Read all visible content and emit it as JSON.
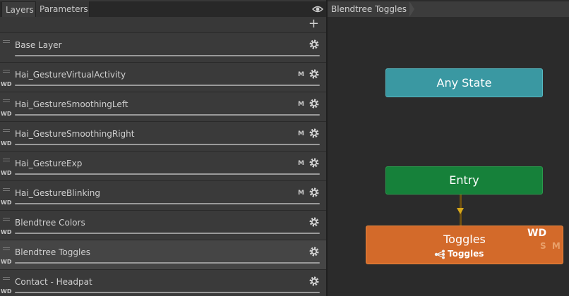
{
  "tabs": [
    {
      "label": "Layers"
    },
    {
      "label": "Parameters"
    }
  ],
  "toolbar": {
    "add_icon": "plus-icon"
  },
  "layers": [
    {
      "name": "Base Layer",
      "wd": "",
      "m": ""
    },
    {
      "name": "Hai_GestureVirtualActivity",
      "wd": "WD",
      "m": "M"
    },
    {
      "name": "Hai_GestureSmoothingLeft",
      "wd": "WD",
      "m": "M"
    },
    {
      "name": "Hai_GestureSmoothingRight",
      "wd": "WD",
      "m": "M"
    },
    {
      "name": "Hai_GestureExp",
      "wd": "WD",
      "m": "M"
    },
    {
      "name": "Hai_GestureBlinking",
      "wd": "WD",
      "m": "M"
    },
    {
      "name": "Blendtree Colors",
      "wd": "WD",
      "m": ""
    },
    {
      "name": "Blendtree Toggles",
      "wd": "WD",
      "m": "",
      "selected": true
    },
    {
      "name": "Contact - Headpat",
      "wd": "WD",
      "m": ""
    }
  ],
  "graph": {
    "breadcrumb": "Blendtree Toggles",
    "nodes": {
      "any_state": {
        "label": "Any State",
        "color": "#3a98a2"
      },
      "entry": {
        "label": "Entry",
        "color": "#16813a"
      },
      "toggles": {
        "label": "Toggles",
        "sub_label": "Toggles",
        "wd": "WD",
        "sm": "S M",
        "color": "#d36a2a"
      }
    }
  }
}
